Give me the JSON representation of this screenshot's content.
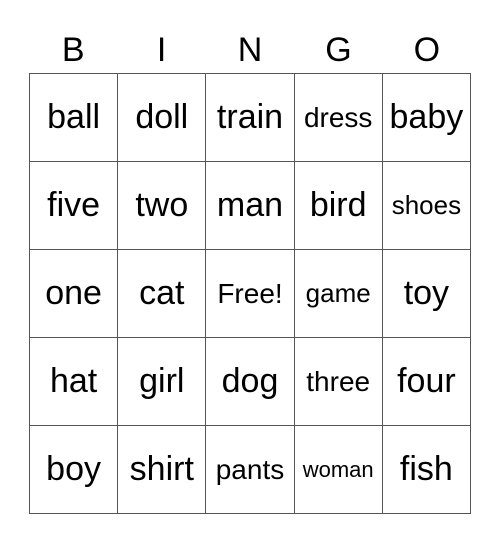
{
  "header": [
    "B",
    "I",
    "N",
    "G",
    "O"
  ],
  "rows": [
    [
      {
        "t": "ball",
        "s": ""
      },
      {
        "t": "doll",
        "s": ""
      },
      {
        "t": "train",
        "s": ""
      },
      {
        "t": "dress",
        "s": "s28"
      },
      {
        "t": "baby",
        "s": ""
      }
    ],
    [
      {
        "t": "five",
        "s": ""
      },
      {
        "t": "two",
        "s": ""
      },
      {
        "t": "man",
        "s": ""
      },
      {
        "t": "bird",
        "s": ""
      },
      {
        "t": "shoes",
        "s": "s26"
      }
    ],
    [
      {
        "t": "one",
        "s": ""
      },
      {
        "t": "cat",
        "s": ""
      },
      {
        "t": "Free!",
        "s": "s28"
      },
      {
        "t": "game",
        "s": "s26"
      },
      {
        "t": "toy",
        "s": ""
      }
    ],
    [
      {
        "t": "hat",
        "s": ""
      },
      {
        "t": "girl",
        "s": ""
      },
      {
        "t": "dog",
        "s": ""
      },
      {
        "t": "three",
        "s": "s28"
      },
      {
        "t": "four",
        "s": ""
      }
    ],
    [
      {
        "t": "boy",
        "s": ""
      },
      {
        "t": "shirt",
        "s": ""
      },
      {
        "t": "pants",
        "s": "s28"
      },
      {
        "t": "woman",
        "s": "s22"
      },
      {
        "t": "fish",
        "s": ""
      }
    ]
  ]
}
